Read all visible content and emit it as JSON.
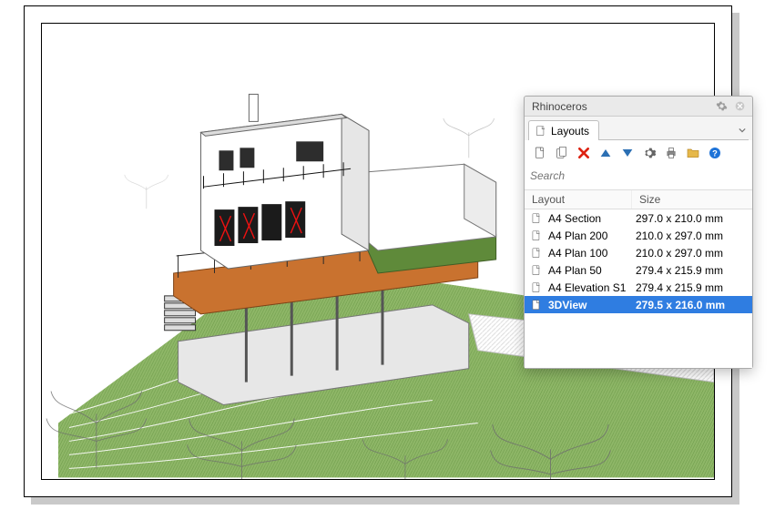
{
  "panel": {
    "title": "Rhinoceros",
    "tab_label": "Layouts",
    "search_placeholder": "Search",
    "columns": {
      "name": "Layout",
      "size": "Size"
    },
    "layouts": [
      {
        "name": "A4 Section",
        "size": "297.0 x 210.0 mm",
        "selected": false
      },
      {
        "name": "A4 Plan 200",
        "size": "210.0 x 297.0 mm",
        "selected": false
      },
      {
        "name": "A4 Plan 100",
        "size": "210.0 x 297.0 mm",
        "selected": false
      },
      {
        "name": "A4 Plan 50",
        "size": "279.4 x 215.9 mm",
        "selected": false
      },
      {
        "name": "A4 Elevation S1",
        "size": "279.4 x 215.9 mm",
        "selected": false
      },
      {
        "name": "3DView",
        "size": "279.5 x 216.0 mm",
        "selected": true
      }
    ]
  },
  "toolbar_icons": [
    {
      "name": "new-layout",
      "kind": "page"
    },
    {
      "name": "copy-layout",
      "kind": "page-copy"
    },
    {
      "name": "delete-layout",
      "kind": "x-red"
    },
    {
      "name": "move-up",
      "kind": "tri-up"
    },
    {
      "name": "move-down",
      "kind": "tri-down"
    },
    {
      "name": "settings",
      "kind": "gear"
    },
    {
      "name": "print",
      "kind": "printer"
    },
    {
      "name": "open-folder",
      "kind": "folder"
    },
    {
      "name": "help",
      "kind": "help"
    }
  ]
}
